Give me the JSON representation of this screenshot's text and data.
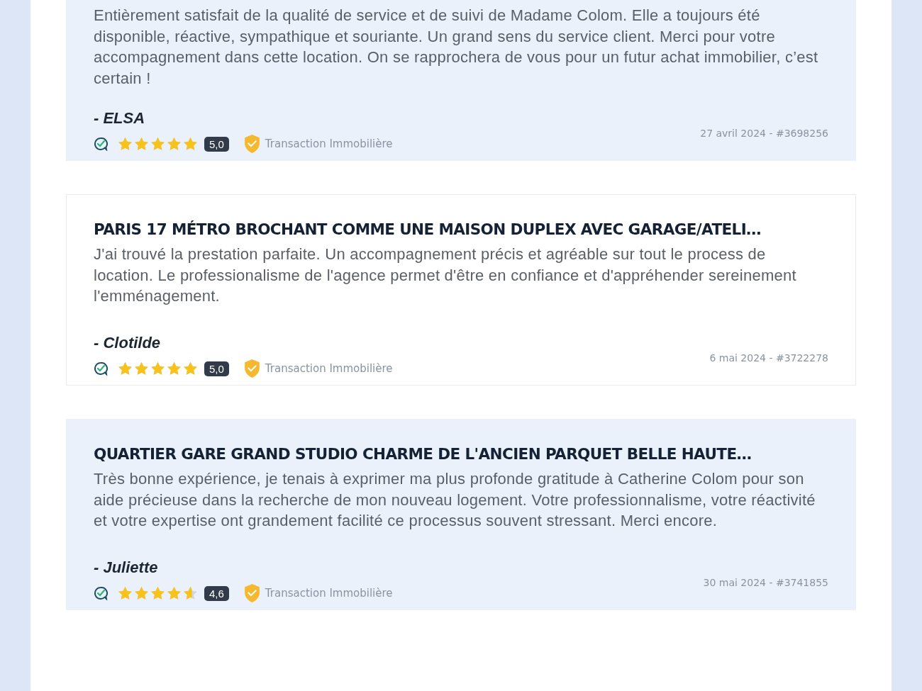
{
  "reviews": [
    {
      "shaded": true,
      "text": "Entièrement satisfait de la qualité de service et de suivi de Madame Colom. Elle a toujours été disponible, réactive, sympathique et souriante. Un grand sens du service client. Merci pour votre accompagnement dans cette location. On se rapprochera de vous pour un futur achat immobilier, c’est certain !",
      "author": "- ELSA",
      "stars": 5,
      "score": "5,0",
      "category": "Transaction Immobilière",
      "reference": "27 avril 2024 - #3698256"
    },
    {
      "shaded": false,
      "title": "PARIS 17 MÉTRO BROCHANT COMME UNE MAISON DUPLEX AVEC GARAGE/ATELI…",
      "text": "J'ai trouvé la prestation parfaite. Un accompagnement précis et agréable sur tout le process de location. Le professionalisme de l'agence permet d'être en confiance et d'appréhender sereinement l'emménagement.",
      "author": "- Clotilde",
      "stars": 5,
      "score": "5,0",
      "category": "Transaction Immobilière",
      "reference": "6 mai 2024 - #3722278"
    },
    {
      "shaded": true,
      "title": "QUARTIER GARE GRAND STUDIO CHARME DE L'ANCIEN PARQUET BELLE HAUTE…",
      "text": "Très bonne expérience, je tenais à exprimer ma plus profonde gratitude à Catherine Colom pour son aide précieuse dans la recherche de mon nouveau logement. Votre professionnalisme, votre réactivité et votre expertise ont grandement facilité ce processus souvent stressant. Merci encore.",
      "author": "- Juliette",
      "stars": 4.6,
      "score": "4,6",
      "category": "Transaction Immobilière",
      "reference": "30 mai 2024 - #3741855"
    }
  ]
}
